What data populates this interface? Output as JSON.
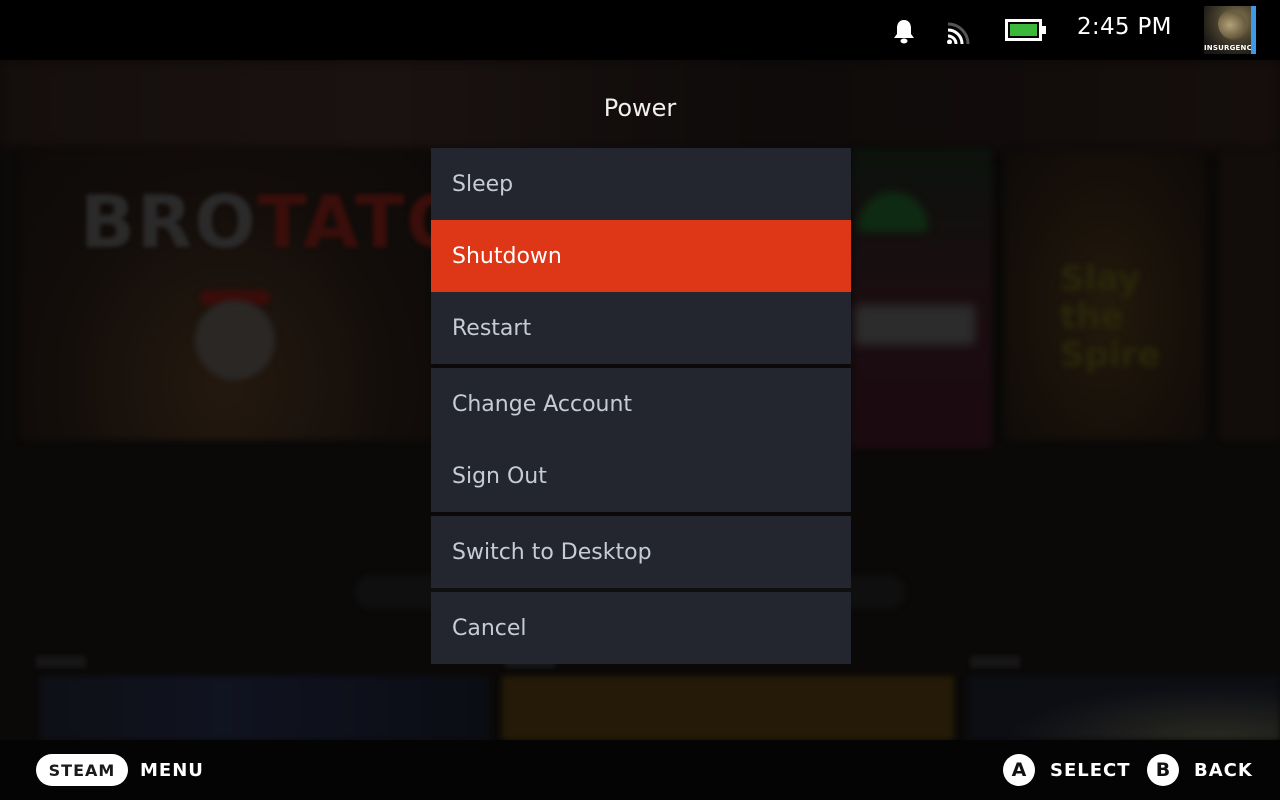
{
  "status_bar": {
    "icons": [
      "bell-icon",
      "wifi-icon",
      "battery-icon"
    ],
    "time": "2:45 PM",
    "battery_level": 1.0,
    "battery_color": "#3bb83b",
    "avatar_label": "INSURGENCY",
    "avatar_accent": "#3d9ae8"
  },
  "background": {
    "featured_games": [
      {
        "title_left": "BRO",
        "title_right": "TATO"
      },
      {
        "title": "Slay the Spire"
      }
    ]
  },
  "dialog": {
    "title": "Power",
    "focused_color": "#dd3717",
    "groups": [
      {
        "items": [
          {
            "label": "Sleep",
            "focused": false
          },
          {
            "label": "Shutdown",
            "focused": true
          },
          {
            "label": "Restart",
            "focused": false
          }
        ]
      },
      {
        "items": [
          {
            "label": "Change Account",
            "focused": false
          },
          {
            "label": "Sign Out",
            "focused": false
          }
        ]
      },
      {
        "items": [
          {
            "label": "Switch to Desktop",
            "focused": false
          }
        ]
      },
      {
        "items": [
          {
            "label": "Cancel",
            "focused": false
          }
        ]
      }
    ]
  },
  "footer": {
    "steam_button": "STEAM",
    "menu_label": "MENU",
    "a_button": "A",
    "select_label": "SELECT",
    "b_button": "B",
    "back_label": "BACK"
  }
}
